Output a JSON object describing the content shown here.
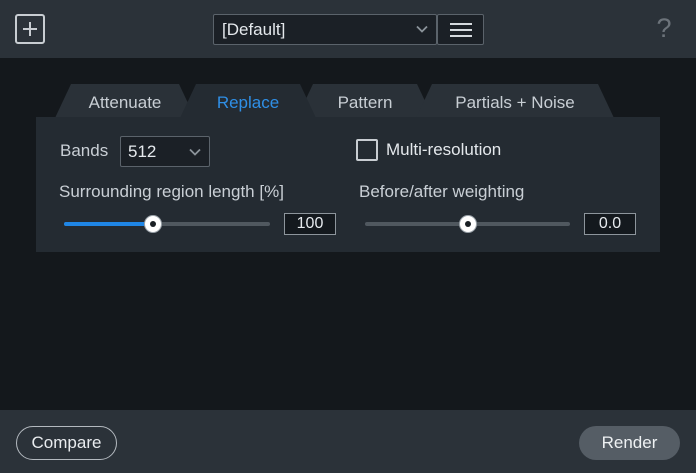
{
  "header": {
    "preset_value": "[Default]",
    "help_symbol": "?"
  },
  "tabs": [
    {
      "label": "Attenuate",
      "active": false
    },
    {
      "label": "Replace",
      "active": true
    },
    {
      "label": "Pattern",
      "active": false
    },
    {
      "label": "Partials + Noise",
      "active": false
    }
  ],
  "replace": {
    "bands_label": "Bands",
    "bands_value": "512",
    "multi_resolution_label": "Multi-resolution",
    "multi_resolution_checked": false,
    "surrounding_label": "Surrounding region length [%]",
    "surrounding_value": "100",
    "surrounding_slider_fraction": 0.43,
    "weighting_label": "Before/after weighting",
    "weighting_value": "0.0",
    "weighting_slider_fraction": 0.5
  },
  "footer": {
    "compare_label": "Compare",
    "render_label": "Render"
  },
  "colors": {
    "accent": "#2f8fe6",
    "background": "#14181c",
    "bar": "#2b3239",
    "panel": "#242b32"
  }
}
